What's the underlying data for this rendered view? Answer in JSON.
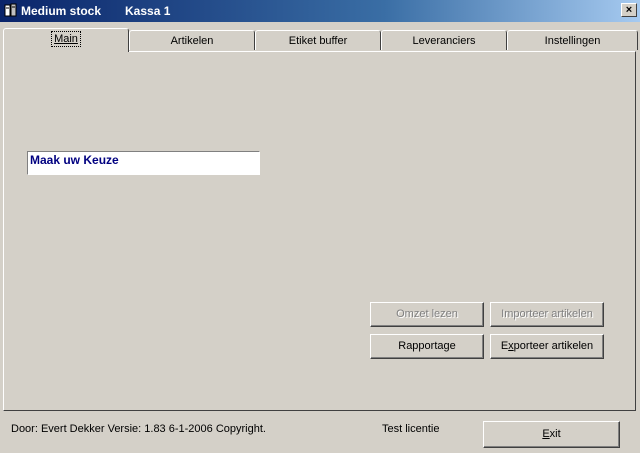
{
  "window": {
    "title": "Medium stock",
    "subtitle": "Kassa 1",
    "close_label": "×"
  },
  "tabs": [
    {
      "label": "Main",
      "active": true
    },
    {
      "label": "Artikelen",
      "active": false
    },
    {
      "label": "Etiket buffer",
      "active": false
    },
    {
      "label": "Leveranciers",
      "active": false
    },
    {
      "label": "Instellingen",
      "active": false
    }
  ],
  "main": {
    "choice_text": "Maak uw Keuze",
    "buttons": {
      "omzet_lezen": {
        "label": "Omzet lezen",
        "enabled": false
      },
      "importeer_artikelen": {
        "label": "Importeer artikelen",
        "enabled": false
      },
      "rapportage": {
        "label": "Rapportage",
        "enabled": true
      },
      "exporteer_artikelen": {
        "label_prefix": "E",
        "label_underlined": "x",
        "label_suffix": "porteer artikelen",
        "enabled": true
      }
    }
  },
  "statusbar": {
    "info": "Door: Evert Dekker Versie: 1.83  6-1-2006 Copyright.",
    "license": "Test licentie",
    "exit_underlined": "E",
    "exit_suffix": "xit"
  },
  "colors": {
    "face": "#d4d0c8",
    "titlebar_start": "#0a246a",
    "titlebar_end": "#a6caf0",
    "field_text": "#000080"
  }
}
